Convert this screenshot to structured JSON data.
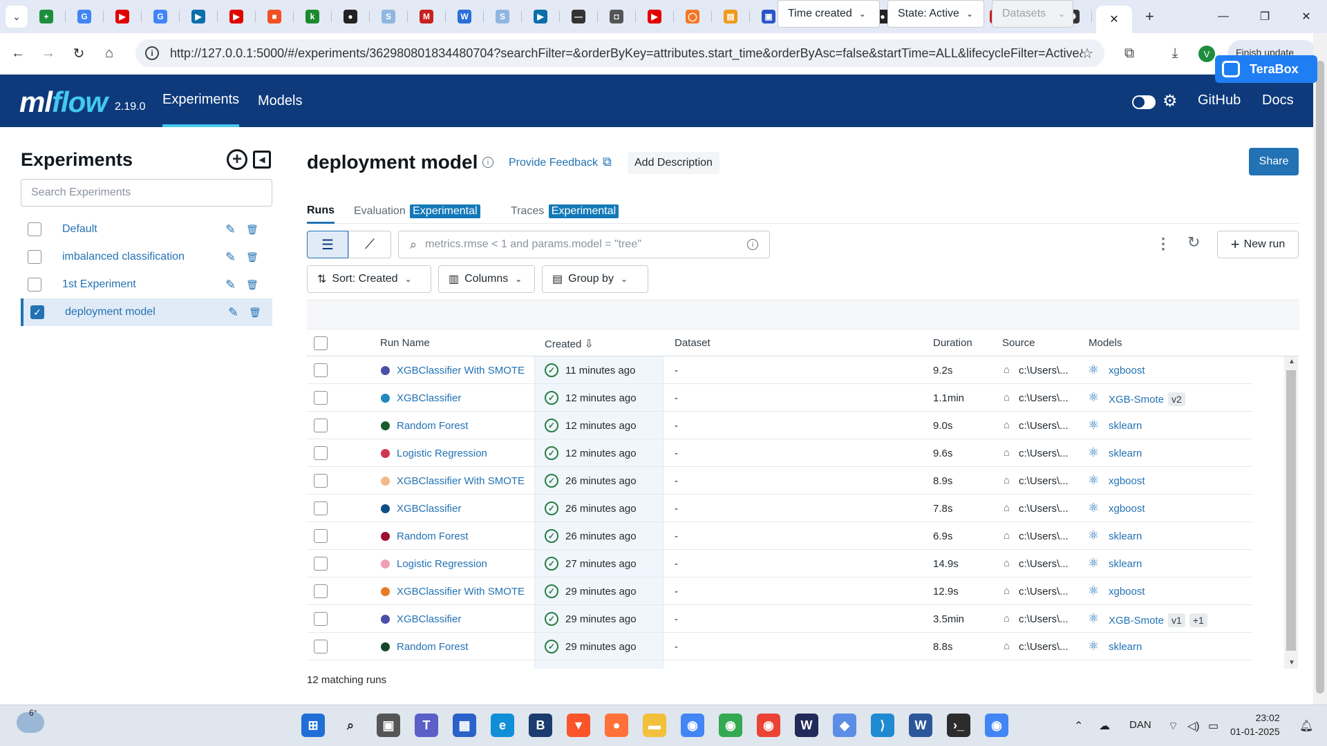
{
  "browser": {
    "tabs": [
      {
        "icon": "sheets-icon",
        "color": "#1e8e3e",
        "glyph": "+"
      },
      {
        "icon": "google-icon",
        "color": "#4285f4",
        "glyph": "G"
      },
      {
        "icon": "youtube-icon",
        "color": "#e00000",
        "glyph": "▶"
      },
      {
        "icon": "google-icon",
        "color": "#4285f4",
        "glyph": "G"
      },
      {
        "icon": "video-icon",
        "color": "#0a6ea8",
        "glyph": "▶"
      },
      {
        "icon": "youtube-icon",
        "color": "#e00000",
        "glyph": "▶"
      },
      {
        "icon": "microsoft-icon",
        "color": "#f25022",
        "glyph": "■"
      },
      {
        "icon": "kaggle-icon",
        "color": "#1b8a2e",
        "glyph": "k"
      },
      {
        "icon": "github-icon",
        "color": "#222222",
        "glyph": "●"
      },
      {
        "icon": "sync-icon",
        "color": "#8fb6e0",
        "glyph": "S"
      },
      {
        "icon": "gmail-icon",
        "color": "#c5221f",
        "glyph": "M"
      },
      {
        "icon": "microsoft-365-icon",
        "color": "#2a6fd6",
        "glyph": "W"
      },
      {
        "icon": "sync-icon",
        "color": "#8fb6e0",
        "glyph": "S"
      },
      {
        "icon": "video-icon",
        "color": "#0a6ea8",
        "glyph": "▶"
      },
      {
        "icon": "notes-icon",
        "color": "#333333",
        "glyph": "—"
      },
      {
        "icon": "camera-icon",
        "color": "#555555",
        "glyph": "◘"
      },
      {
        "icon": "youtube-icon",
        "color": "#e00000",
        "glyph": "▶"
      },
      {
        "icon": "jupyter-icon",
        "color": "#f37726",
        "glyph": "◯"
      },
      {
        "icon": "book-icon",
        "color": "#f09a1a",
        "glyph": "▤"
      },
      {
        "icon": "contact-icon",
        "color": "#2a56c6",
        "glyph": "▣"
      },
      {
        "icon": "whatsapp-icon",
        "color": "#25a244",
        "glyph": "✆"
      },
      {
        "icon": "docs-icon",
        "color": "#2f6ff0",
        "glyph": "≡"
      },
      {
        "icon": "github-icon",
        "color": "#222222",
        "glyph": "●"
      },
      {
        "icon": "gmail-icon",
        "color": "#c5221f",
        "glyph": "M"
      },
      {
        "icon": "notes-icon",
        "color": "#333333",
        "glyph": "—"
      },
      {
        "icon": "gmail-icon",
        "color": "#c5221f",
        "glyph": "M"
      },
      {
        "icon": "contact-icon",
        "color": "#2a56c6",
        "glyph": "▣"
      },
      {
        "icon": "chatgpt-icon",
        "color": "#333333",
        "glyph": "✺"
      }
    ],
    "active_tab_close": "✕",
    "new_tab": "+",
    "url": "http://127.0.0.1:5000/#/experiments/362980801834480704?searchFilter=&orderByKey=attributes.start_time&orderByAsc=false&startTime=ALL&lifecycleFilter=Active&...",
    "profile_initial": "V",
    "update_label": "Finish update",
    "terabox_label": "TeraBox"
  },
  "header": {
    "logo_ml": "ml",
    "logo_flow": "flow",
    "version": "2.19.0",
    "nav": [
      "Experiments",
      "Models"
    ],
    "links": [
      "GitHub",
      "Docs"
    ]
  },
  "sidebar": {
    "title": "Experiments",
    "search_placeholder": "Search Experiments",
    "experiments": [
      {
        "name": "Default",
        "selected": false
      },
      {
        "name": "imbalanced classification",
        "selected": false
      },
      {
        "name": "1st Experiment",
        "selected": false
      },
      {
        "name": "deployment model",
        "selected": true
      }
    ]
  },
  "main": {
    "title": "deployment model",
    "feedback": "Provide Feedback",
    "add_description": "Add Description",
    "share": "Share",
    "tabs": [
      {
        "label": "Runs",
        "badge": ""
      },
      {
        "label": "Evaluation",
        "badge": "Experimental"
      },
      {
        "label": "Traces",
        "badge": "Experimental"
      }
    ],
    "filter_placeholder": "metrics.rmse < 1 and params.model = \"tree\"",
    "time_created": "Time created",
    "state": "State: Active",
    "datasets": "Datasets",
    "new_run": "New run",
    "sort": "Sort: Created",
    "columns": "Columns",
    "group_by": "Group by"
  },
  "table": {
    "headers": [
      "Run Name",
      "Created",
      "Dataset",
      "Duration",
      "Source",
      "Models"
    ],
    "rows": [
      {
        "color": "#4b4fa8",
        "name": "XGBClassifier With SMOTE",
        "created": "11 minutes ago",
        "dataset": "-",
        "duration": "9.2s",
        "source": "c:\\Users\\...",
        "model": "xgboost",
        "versions": []
      },
      {
        "color": "#1f8ac0",
        "name": "XGBClassifier",
        "created": "12 minutes ago",
        "dataset": "-",
        "duration": "1.1min",
        "source": "c:\\Users\\...",
        "model": "XGB-Smote",
        "versions": [
          "v2"
        ]
      },
      {
        "color": "#1a5c2e",
        "name": "Random Forest",
        "created": "12 minutes ago",
        "dataset": "-",
        "duration": "9.0s",
        "source": "c:\\Users\\...",
        "model": "sklearn",
        "versions": []
      },
      {
        "color": "#d0364f",
        "name": "Logistic Regression",
        "created": "12 minutes ago",
        "dataset": "-",
        "duration": "9.6s",
        "source": "c:\\Users\\...",
        "model": "sklearn",
        "versions": []
      },
      {
        "color": "#f2b98a",
        "name": "XGBClassifier With SMOTE",
        "created": "26 minutes ago",
        "dataset": "-",
        "duration": "8.9s",
        "source": "c:\\Users\\...",
        "model": "xgboost",
        "versions": []
      },
      {
        "color": "#0e4f86",
        "name": "XGBClassifier",
        "created": "26 minutes ago",
        "dataset": "-",
        "duration": "7.8s",
        "source": "c:\\Users\\...",
        "model": "xgboost",
        "versions": []
      },
      {
        "color": "#9b1030",
        "name": "Random Forest",
        "created": "26 minutes ago",
        "dataset": "-",
        "duration": "6.9s",
        "source": "c:\\Users\\...",
        "model": "sklearn",
        "versions": []
      },
      {
        "color": "#f0a0b4",
        "name": "Logistic Regression",
        "created": "27 minutes ago",
        "dataset": "-",
        "duration": "14.9s",
        "source": "c:\\Users\\...",
        "model": "sklearn",
        "versions": []
      },
      {
        "color": "#e87c22",
        "name": "XGBClassifier With SMOTE",
        "created": "29 minutes ago",
        "dataset": "-",
        "duration": "12.9s",
        "source": "c:\\Users\\...",
        "model": "xgboost",
        "versions": []
      },
      {
        "color": "#4b4fa8",
        "name": "XGBClassifier",
        "created": "29 minutes ago",
        "dataset": "-",
        "duration": "3.5min",
        "source": "c:\\Users\\...",
        "model": "XGB-Smote",
        "versions": [
          "v1",
          "+1"
        ]
      },
      {
        "color": "#15472a",
        "name": "Random Forest",
        "created": "29 minutes ago",
        "dataset": "-",
        "duration": "8.8s",
        "source": "c:\\Users\\...",
        "model": "sklearn",
        "versions": []
      }
    ],
    "matching": "12 matching runs"
  },
  "taskbar": {
    "weather_temp": "6°",
    "apps": [
      {
        "icon": "start-icon",
        "color": "#1f6fd6",
        "glyph": "⊞"
      },
      {
        "icon": "search-icon",
        "color": "#dfe6ee",
        "glyph": "⌕"
      },
      {
        "icon": "task-view-icon",
        "color": "#555555",
        "glyph": "▣"
      },
      {
        "icon": "teams-icon",
        "color": "#5b5fc7",
        "glyph": "T"
      },
      {
        "icon": "store-icon",
        "color": "#2a62c9",
        "glyph": "▦"
      },
      {
        "icon": "edge-icon",
        "color": "#0f8fd8",
        "glyph": "e"
      },
      {
        "icon": "b-app-icon",
        "color": "#1a3c6e",
        "glyph": "B"
      },
      {
        "icon": "brave-icon",
        "color": "#fb542b",
        "glyph": "▼"
      },
      {
        "icon": "firefox-icon",
        "color": "#ff7139",
        "glyph": "●"
      },
      {
        "icon": "file-explorer-icon",
        "color": "#f2c03b",
        "glyph": "▬"
      },
      {
        "icon": "chrome-icon",
        "color": "#4285f4",
        "glyph": "◉"
      },
      {
        "icon": "chrome-icon",
        "color": "#34a853",
        "glyph": "◉"
      },
      {
        "icon": "chrome-icon",
        "color": "#ea4335",
        "glyph": "◉"
      },
      {
        "icon": "wavelink-icon",
        "color": "#222a5a",
        "glyph": "W"
      },
      {
        "icon": "git-icon",
        "color": "#5c8ee6",
        "glyph": "◆"
      },
      {
        "icon": "vscode-icon",
        "color": "#1f8ad2",
        "glyph": "⟩"
      },
      {
        "icon": "word-icon",
        "color": "#2b579a",
        "glyph": "W"
      },
      {
        "icon": "terminal-icon",
        "color": "#2c2c2c",
        "glyph": "›_"
      },
      {
        "icon": "chrome-icon",
        "color": "#4285f4",
        "glyph": "◉"
      }
    ],
    "language": "DAN",
    "time": "23:02",
    "date": "01-01-2025"
  }
}
